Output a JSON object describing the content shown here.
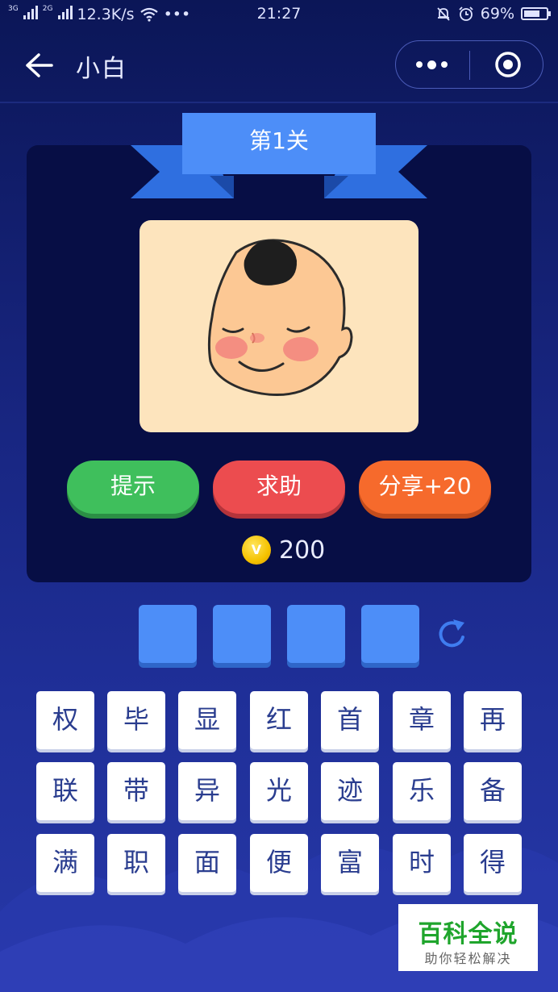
{
  "status_bar": {
    "network_3g": "3G",
    "network_2g": "2G",
    "speed": "12.3K/s",
    "dots": "•••",
    "time": "21:27",
    "battery": "69%"
  },
  "nav": {
    "title": "小白"
  },
  "level": {
    "label": "第1关"
  },
  "buttons": {
    "hint": "提示",
    "help": "求助",
    "share": "分享+20"
  },
  "coins": {
    "symbol": "V",
    "count": "200"
  },
  "answer_slots": [
    "",
    "",
    "",
    ""
  ],
  "keyboard": [
    [
      "权",
      "毕",
      "显",
      "红",
      "首",
      "章",
      "再"
    ],
    [
      "联",
      "带",
      "异",
      "光",
      "迹",
      "乐",
      "备"
    ],
    [
      "满",
      "职",
      "面",
      "便",
      "富",
      "时",
      "得"
    ]
  ],
  "watermark": {
    "title": "百科全说",
    "subtitle": "助你轻松解决"
  },
  "colors": {
    "background": "#16237a",
    "panel": "#070e45",
    "hint_button": "#3fbf5c",
    "help_button": "#ec4c4f",
    "share_button": "#f66a2c",
    "answer_slot": "#4d8ef8",
    "ribbon": "#4d8ef8"
  }
}
